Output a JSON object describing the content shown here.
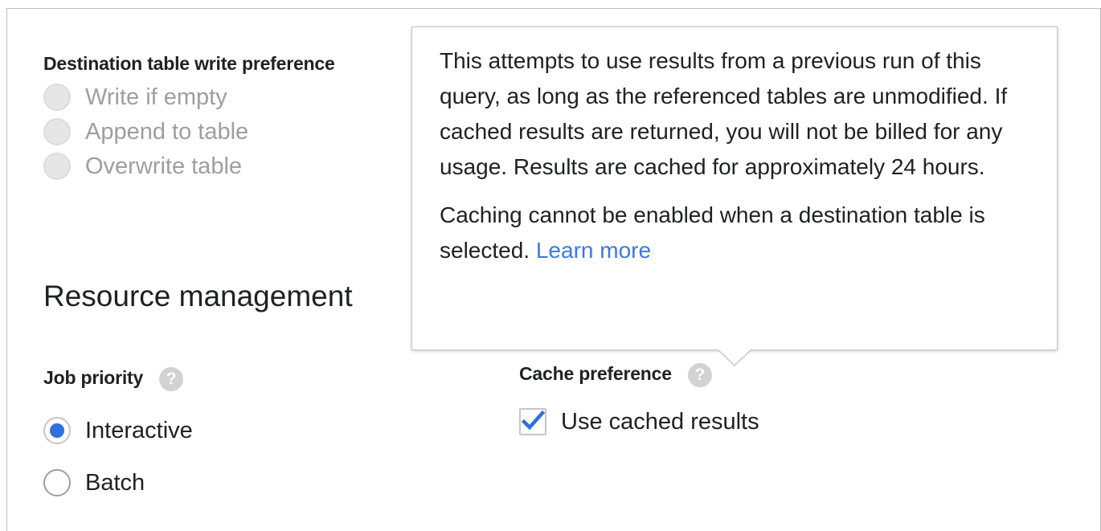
{
  "write_preference": {
    "label": "Destination table write preference",
    "options": [
      {
        "label": "Write if empty",
        "state": "disabled"
      },
      {
        "label": "Append to table",
        "state": "disabled"
      },
      {
        "label": "Overwrite table",
        "state": "disabled"
      }
    ]
  },
  "resource_management": {
    "heading": "Resource management"
  },
  "job_priority": {
    "label": "Job priority",
    "options": [
      {
        "label": "Interactive",
        "selected": true
      },
      {
        "label": "Batch",
        "selected": false
      }
    ]
  },
  "cache_preference": {
    "label": "Cache preference",
    "checkbox_label": "Use cached results",
    "checked": true
  },
  "tooltip": {
    "paragraph1": "This attempts to use results from a previous run of this query, as long as the referenced tables are unmodified. If cached results are returned, you will not be billed for any usage. Results are cached for approximately 24 hours.",
    "paragraph2": "Caching cannot be enabled when a destination table is selected.",
    "link": "Learn more"
  },
  "colors": {
    "accent": "#2f6fe0",
    "link": "#3b78e7",
    "disabled_text": "#9e9e9e"
  },
  "icons": {
    "help": "?"
  }
}
